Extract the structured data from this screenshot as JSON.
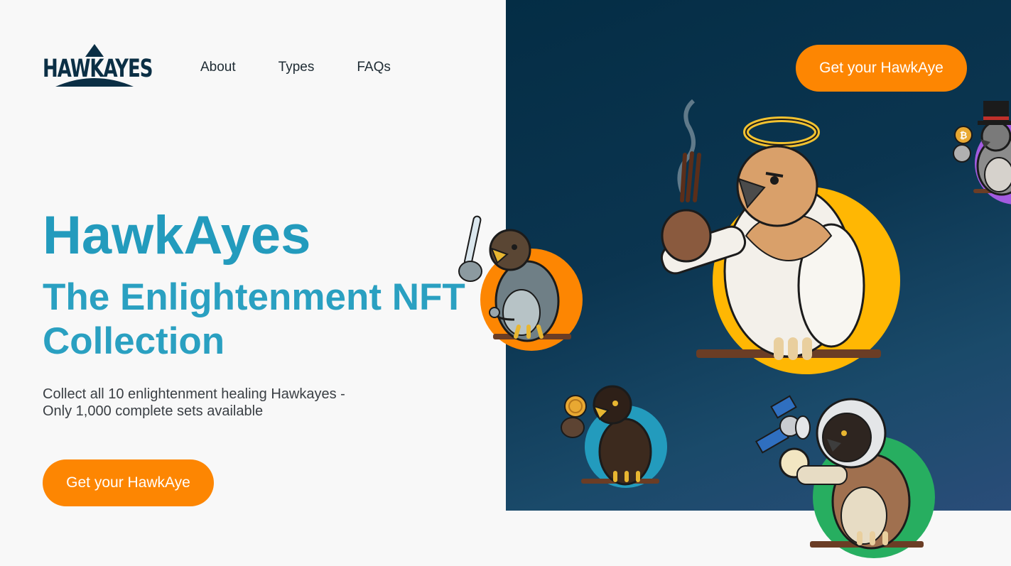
{
  "brand": {
    "logo_text": "HAWKAYES"
  },
  "nav": {
    "items": [
      {
        "label": "About"
      },
      {
        "label": "Types"
      },
      {
        "label": "FAQs"
      }
    ]
  },
  "header": {
    "cta_label": "Get your HawkAye"
  },
  "hero": {
    "title": "HawkAyes",
    "subtitle": "The Enlightenment NFT Collection",
    "description_line1": "Collect all 10 enlightenment healing Hawkayes -",
    "description_line2": "Only 1,000 complete sets available",
    "cta_label": "Get your HawkAye"
  },
  "colors": {
    "accent": "#fd8602",
    "title": "#239bbd",
    "panel": "#042d45",
    "circle_orange": "#fd8602",
    "circle_yellow": "#ffb703",
    "circle_blue": "#239bbd",
    "circle_green": "#27ae60",
    "circle_purple": "#a35be0"
  },
  "characters": [
    {
      "name": "doctor-hawk",
      "icon": "thermometer-icon"
    },
    {
      "name": "angel-hawk",
      "icon": "halo-icon"
    },
    {
      "name": "crypto-hawk",
      "icon": "coin-icon"
    },
    {
      "name": "astronaut-hawk",
      "icon": "satellite-icon"
    },
    {
      "name": "tophat-hawk",
      "icon": "bitcoin-icon"
    }
  ]
}
